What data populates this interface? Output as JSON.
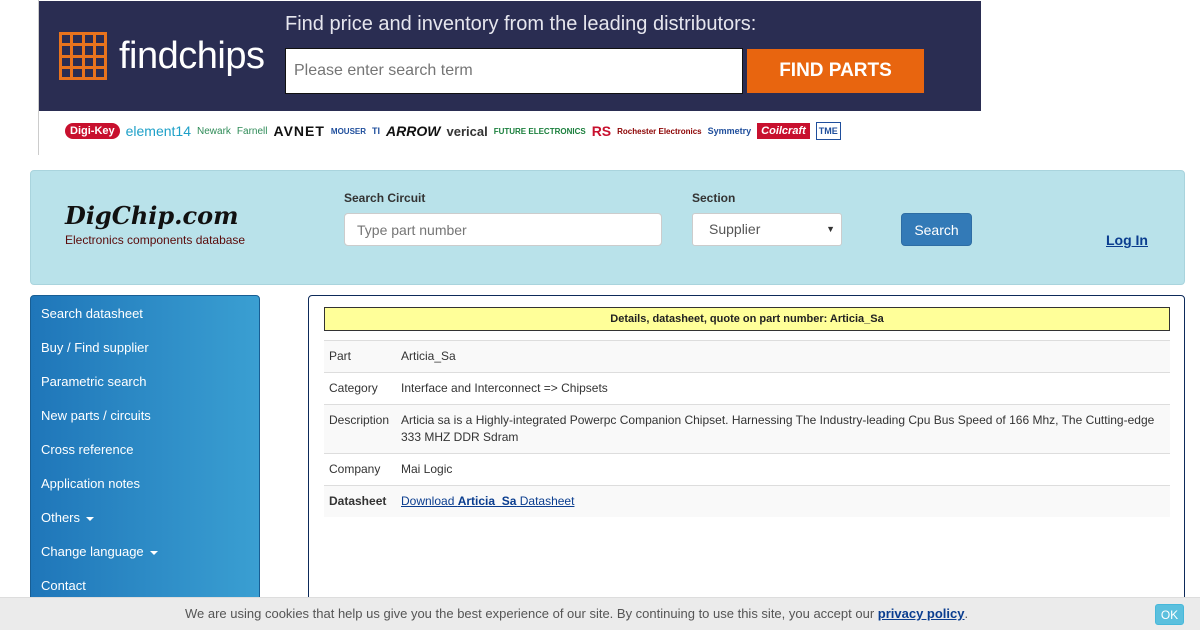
{
  "findchips": {
    "brand": "findchips",
    "headline": "Find price and inventory from the leading distributors:",
    "search_placeholder": "Please enter search term",
    "find_button": "FIND PARTS",
    "distributors": [
      "Digi-Key",
      "element14",
      "Newark",
      "Farnell",
      "AVNET",
      "MOUSER",
      "TI",
      "ARROW",
      "verical",
      "FUTURE ELECTRONICS",
      "RS",
      "Rochester Electronics",
      "Symmetry",
      "Coilcraft",
      "TME"
    ],
    "colors": {
      "banner_bg": "#2a2d52",
      "accent": "#e8650f"
    }
  },
  "header": {
    "logo": "DigChip.com",
    "tagline": "Electronics components database",
    "search_label": "Search Circuit",
    "search_placeholder": "Type part number",
    "section_label": "Section",
    "section_value": "Supplier",
    "search_button": "Search",
    "login": "Log In"
  },
  "sidebar": {
    "items": [
      {
        "label": "Search datasheet",
        "dropdown": false
      },
      {
        "label": "Buy / Find supplier",
        "dropdown": false
      },
      {
        "label": "Parametric search",
        "dropdown": false
      },
      {
        "label": "New parts / circuits",
        "dropdown": false
      },
      {
        "label": "Cross reference",
        "dropdown": false
      },
      {
        "label": "Application notes",
        "dropdown": false
      },
      {
        "label": "Others",
        "dropdown": true
      },
      {
        "label": "Change language",
        "dropdown": true
      },
      {
        "label": "Contact",
        "dropdown": false
      }
    ]
  },
  "main": {
    "title": "Details, datasheet, quote on part number: Articia_Sa",
    "rows": [
      {
        "key": "Part",
        "value": "Articia_Sa"
      },
      {
        "key": "Category",
        "value": "Interface and Interconnect => Chipsets"
      },
      {
        "key": "Description",
        "value": "Articia sa is a Highly-integrated Powerpc Companion Chipset. Harnessing The Industry-leading Cpu Bus Speed of 166 Mhz, The Cutting-edge 333 MHZ DDR Sdram"
      },
      {
        "key": "Company",
        "value": "Mai Logic"
      }
    ],
    "datasheet": {
      "key": "Datasheet",
      "prefix": "Download ",
      "part": "Articia_Sa",
      "suffix": " Datasheet"
    }
  },
  "cookie": {
    "text": "We are using cookies that help us give you the best experience of our site. By continuing to use this site, you accept our ",
    "link": "privacy policy",
    "end": ".",
    "ok": "OK"
  }
}
